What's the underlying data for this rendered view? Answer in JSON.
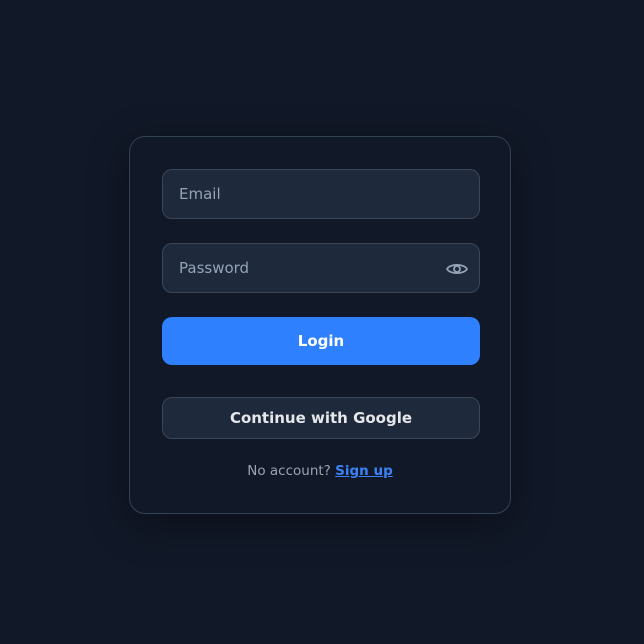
{
  "login_form": {
    "email": {
      "placeholder": "Email",
      "value": ""
    },
    "password": {
      "placeholder": "Password",
      "value": "",
      "toggle_icon": "eye-icon"
    },
    "login_button_label": "Login",
    "google_button_label": "Continue with Google",
    "footer": {
      "prompt": "No account?",
      "signup_link": "Sign up"
    }
  },
  "colors": {
    "background": "#111827",
    "card_border": "#334155",
    "input_background": "#1e293b",
    "accent": "#2f80ff",
    "link": "#3b82f6",
    "muted_text": "#9ca3af"
  }
}
